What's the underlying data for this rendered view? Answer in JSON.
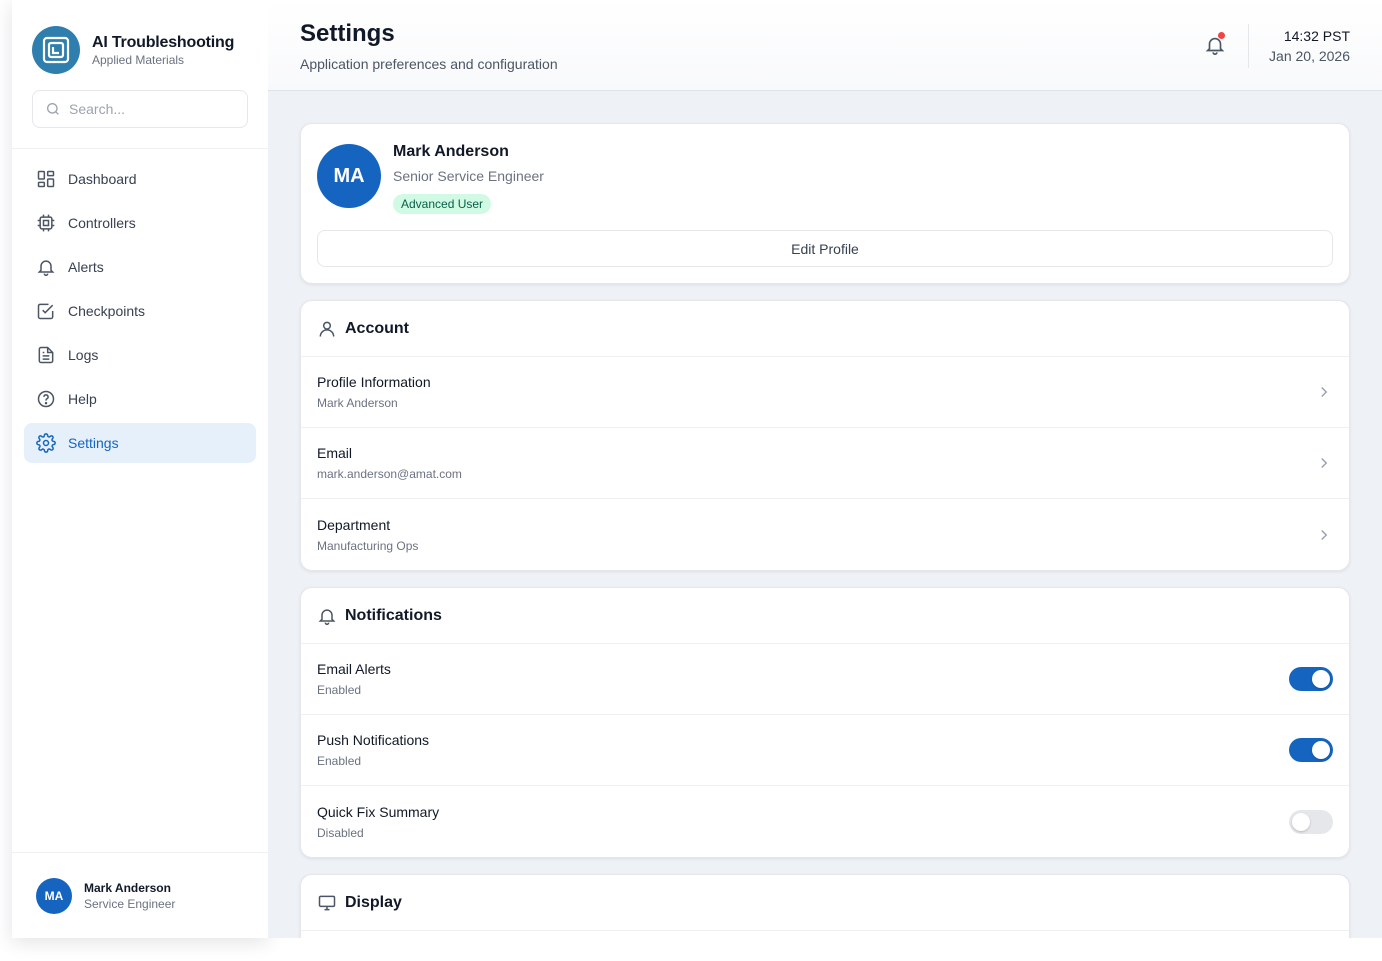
{
  "brand": {
    "title": "AI Troubleshooting",
    "subtitle": "Applied Materials"
  },
  "search": {
    "placeholder": "Search..."
  },
  "sidebar": {
    "items": [
      {
        "label": "Dashboard",
        "icon": "dashboard-icon"
      },
      {
        "label": "Controllers",
        "icon": "chip-icon"
      },
      {
        "label": "Alerts",
        "icon": "bell-icon"
      },
      {
        "label": "Checkpoints",
        "icon": "checkbox-icon"
      },
      {
        "label": "Logs",
        "icon": "document-icon"
      },
      {
        "label": "Help",
        "icon": "help-icon"
      },
      {
        "label": "Settings",
        "icon": "gear-icon",
        "active": true
      }
    ],
    "user": {
      "initials": "MA",
      "name": "Mark Anderson",
      "role": "Service Engineer"
    }
  },
  "header": {
    "title": "Settings",
    "subtitle": "Application preferences and configuration",
    "time": "14:32 PST",
    "date": "Jan 20, 2026",
    "notification_dot": true
  },
  "profile": {
    "initials": "MA",
    "name": "Mark Anderson",
    "role": "Senior Service Engineer",
    "badge": "Advanced User",
    "edit_label": "Edit Profile"
  },
  "account": {
    "title": "Account",
    "rows": [
      {
        "label": "Profile Information",
        "value": "Mark Anderson"
      },
      {
        "label": "Email",
        "value": "mark.anderson@amat.com"
      },
      {
        "label": "Department",
        "value": "Manufacturing Ops"
      }
    ]
  },
  "notifications": {
    "title": "Notifications",
    "rows": [
      {
        "label": "Email Alerts",
        "value": "Enabled",
        "on": true
      },
      {
        "label": "Push Notifications",
        "value": "Enabled",
        "on": true
      },
      {
        "label": "Quick Fix Summary",
        "value": "Disabled",
        "on": false
      }
    ]
  },
  "display": {
    "title": "Display"
  },
  "colors": {
    "accent": "#1565c0",
    "active_bg": "#e6f0fb",
    "badge_bg": "#d1fae5",
    "badge_text": "#065f46",
    "alert_dot": "#ef4444"
  }
}
